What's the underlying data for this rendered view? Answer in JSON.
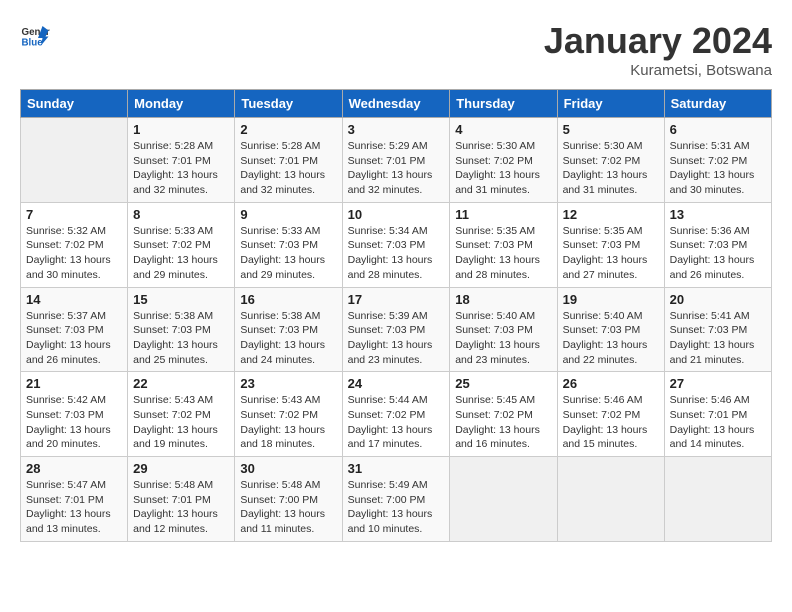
{
  "header": {
    "logo_line1": "General",
    "logo_line2": "Blue",
    "month": "January 2024",
    "location": "Kurametsi, Botswana"
  },
  "weekdays": [
    "Sunday",
    "Monday",
    "Tuesday",
    "Wednesday",
    "Thursday",
    "Friday",
    "Saturday"
  ],
  "weeks": [
    [
      {
        "day": "",
        "info": ""
      },
      {
        "day": "1",
        "info": "Sunrise: 5:28 AM\nSunset: 7:01 PM\nDaylight: 13 hours\nand 32 minutes."
      },
      {
        "day": "2",
        "info": "Sunrise: 5:28 AM\nSunset: 7:01 PM\nDaylight: 13 hours\nand 32 minutes."
      },
      {
        "day": "3",
        "info": "Sunrise: 5:29 AM\nSunset: 7:01 PM\nDaylight: 13 hours\nand 32 minutes."
      },
      {
        "day": "4",
        "info": "Sunrise: 5:30 AM\nSunset: 7:02 PM\nDaylight: 13 hours\nand 31 minutes."
      },
      {
        "day": "5",
        "info": "Sunrise: 5:30 AM\nSunset: 7:02 PM\nDaylight: 13 hours\nand 31 minutes."
      },
      {
        "day": "6",
        "info": "Sunrise: 5:31 AM\nSunset: 7:02 PM\nDaylight: 13 hours\nand 30 minutes."
      }
    ],
    [
      {
        "day": "7",
        "info": "Sunrise: 5:32 AM\nSunset: 7:02 PM\nDaylight: 13 hours\nand 30 minutes."
      },
      {
        "day": "8",
        "info": "Sunrise: 5:33 AM\nSunset: 7:02 PM\nDaylight: 13 hours\nand 29 minutes."
      },
      {
        "day": "9",
        "info": "Sunrise: 5:33 AM\nSunset: 7:03 PM\nDaylight: 13 hours\nand 29 minutes."
      },
      {
        "day": "10",
        "info": "Sunrise: 5:34 AM\nSunset: 7:03 PM\nDaylight: 13 hours\nand 28 minutes."
      },
      {
        "day": "11",
        "info": "Sunrise: 5:35 AM\nSunset: 7:03 PM\nDaylight: 13 hours\nand 28 minutes."
      },
      {
        "day": "12",
        "info": "Sunrise: 5:35 AM\nSunset: 7:03 PM\nDaylight: 13 hours\nand 27 minutes."
      },
      {
        "day": "13",
        "info": "Sunrise: 5:36 AM\nSunset: 7:03 PM\nDaylight: 13 hours\nand 26 minutes."
      }
    ],
    [
      {
        "day": "14",
        "info": "Sunrise: 5:37 AM\nSunset: 7:03 PM\nDaylight: 13 hours\nand 26 minutes."
      },
      {
        "day": "15",
        "info": "Sunrise: 5:38 AM\nSunset: 7:03 PM\nDaylight: 13 hours\nand 25 minutes."
      },
      {
        "day": "16",
        "info": "Sunrise: 5:38 AM\nSunset: 7:03 PM\nDaylight: 13 hours\nand 24 minutes."
      },
      {
        "day": "17",
        "info": "Sunrise: 5:39 AM\nSunset: 7:03 PM\nDaylight: 13 hours\nand 23 minutes."
      },
      {
        "day": "18",
        "info": "Sunrise: 5:40 AM\nSunset: 7:03 PM\nDaylight: 13 hours\nand 23 minutes."
      },
      {
        "day": "19",
        "info": "Sunrise: 5:40 AM\nSunset: 7:03 PM\nDaylight: 13 hours\nand 22 minutes."
      },
      {
        "day": "20",
        "info": "Sunrise: 5:41 AM\nSunset: 7:03 PM\nDaylight: 13 hours\nand 21 minutes."
      }
    ],
    [
      {
        "day": "21",
        "info": "Sunrise: 5:42 AM\nSunset: 7:03 PM\nDaylight: 13 hours\nand 20 minutes."
      },
      {
        "day": "22",
        "info": "Sunrise: 5:43 AM\nSunset: 7:02 PM\nDaylight: 13 hours\nand 19 minutes."
      },
      {
        "day": "23",
        "info": "Sunrise: 5:43 AM\nSunset: 7:02 PM\nDaylight: 13 hours\nand 18 minutes."
      },
      {
        "day": "24",
        "info": "Sunrise: 5:44 AM\nSunset: 7:02 PM\nDaylight: 13 hours\nand 17 minutes."
      },
      {
        "day": "25",
        "info": "Sunrise: 5:45 AM\nSunset: 7:02 PM\nDaylight: 13 hours\nand 16 minutes."
      },
      {
        "day": "26",
        "info": "Sunrise: 5:46 AM\nSunset: 7:02 PM\nDaylight: 13 hours\nand 15 minutes."
      },
      {
        "day": "27",
        "info": "Sunrise: 5:46 AM\nSunset: 7:01 PM\nDaylight: 13 hours\nand 14 minutes."
      }
    ],
    [
      {
        "day": "28",
        "info": "Sunrise: 5:47 AM\nSunset: 7:01 PM\nDaylight: 13 hours\nand 13 minutes."
      },
      {
        "day": "29",
        "info": "Sunrise: 5:48 AM\nSunset: 7:01 PM\nDaylight: 13 hours\nand 12 minutes."
      },
      {
        "day": "30",
        "info": "Sunrise: 5:48 AM\nSunset: 7:00 PM\nDaylight: 13 hours\nand 11 minutes."
      },
      {
        "day": "31",
        "info": "Sunrise: 5:49 AM\nSunset: 7:00 PM\nDaylight: 13 hours\nand 10 minutes."
      },
      {
        "day": "",
        "info": ""
      },
      {
        "day": "",
        "info": ""
      },
      {
        "day": "",
        "info": ""
      }
    ]
  ]
}
